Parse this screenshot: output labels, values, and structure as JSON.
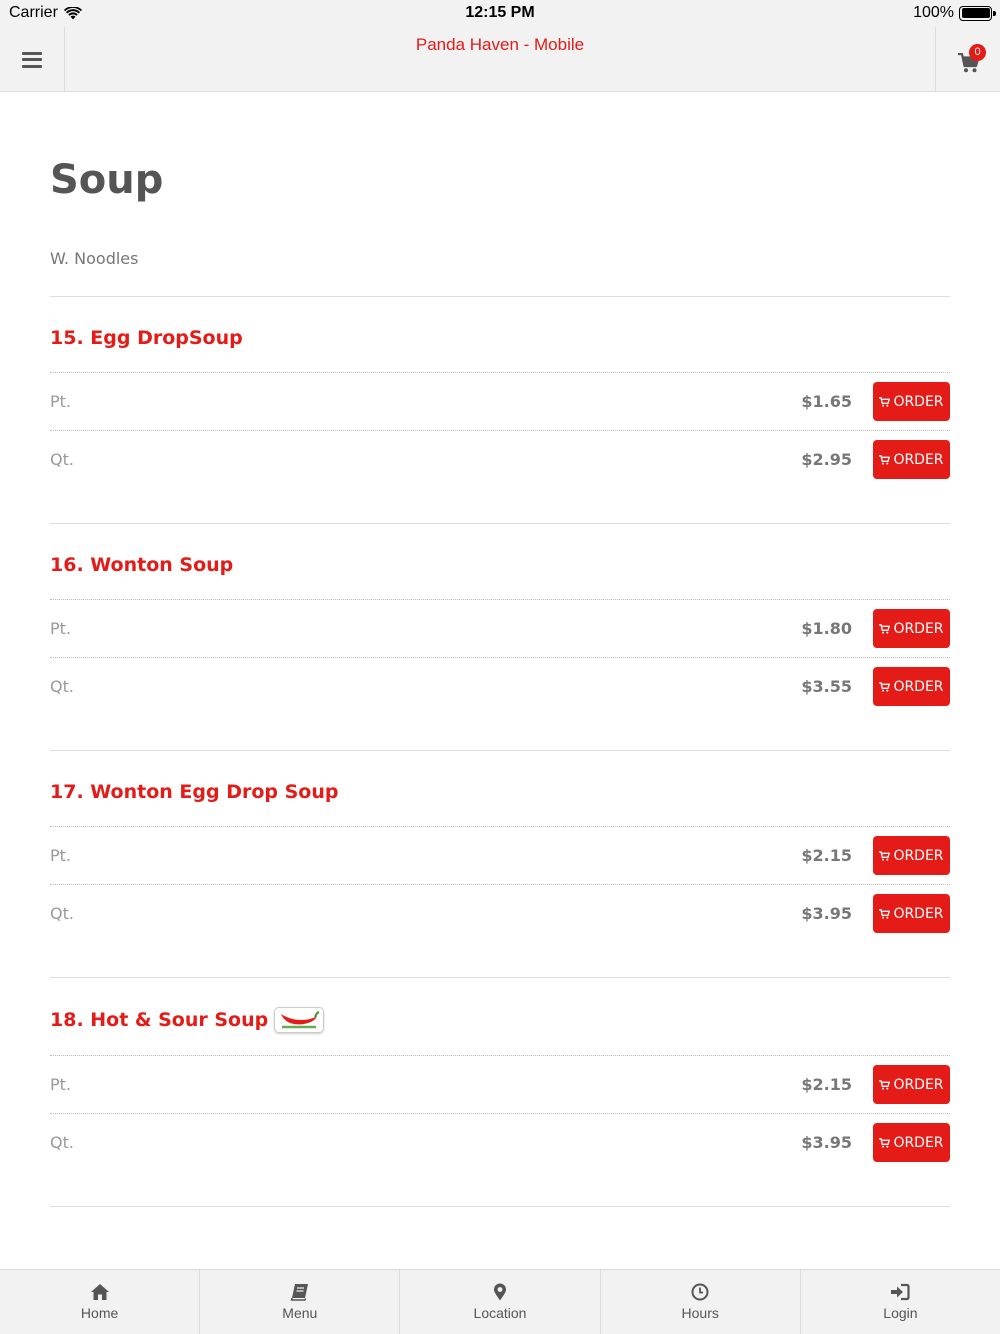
{
  "status_bar": {
    "carrier": "Carrier",
    "time": "12:15 PM",
    "battery": "100%"
  },
  "header": {
    "title": "Panda Haven - Mobile",
    "cart_count": "0"
  },
  "page": {
    "title": "Soup",
    "subtitle": "W. Noodles"
  },
  "order_label": "ORDER",
  "items": [
    {
      "name": "15. Egg DropSoup",
      "spicy": false,
      "sizes": [
        {
          "label": "Pt.",
          "price": "$1.65"
        },
        {
          "label": "Qt.",
          "price": "$2.95"
        }
      ]
    },
    {
      "name": "16. Wonton Soup",
      "spicy": false,
      "sizes": [
        {
          "label": "Pt.",
          "price": "$1.80"
        },
        {
          "label": "Qt.",
          "price": "$3.55"
        }
      ]
    },
    {
      "name": "17. Wonton Egg Drop Soup",
      "spicy": false,
      "sizes": [
        {
          "label": "Pt.",
          "price": "$2.15"
        },
        {
          "label": "Qt.",
          "price": "$3.95"
        }
      ]
    },
    {
      "name": "18. Hot & Sour Soup",
      "spicy": true,
      "sizes": [
        {
          "label": "Pt.",
          "price": "$2.15"
        },
        {
          "label": "Qt.",
          "price": "$3.95"
        }
      ]
    }
  ],
  "tabbar": {
    "home": "Home",
    "menu": "Menu",
    "location": "Location",
    "hours": "Hours",
    "login": "Login"
  },
  "colors": {
    "accent": "#e41b17",
    "header_bg": "#f2f2f2",
    "text": "#555555"
  }
}
